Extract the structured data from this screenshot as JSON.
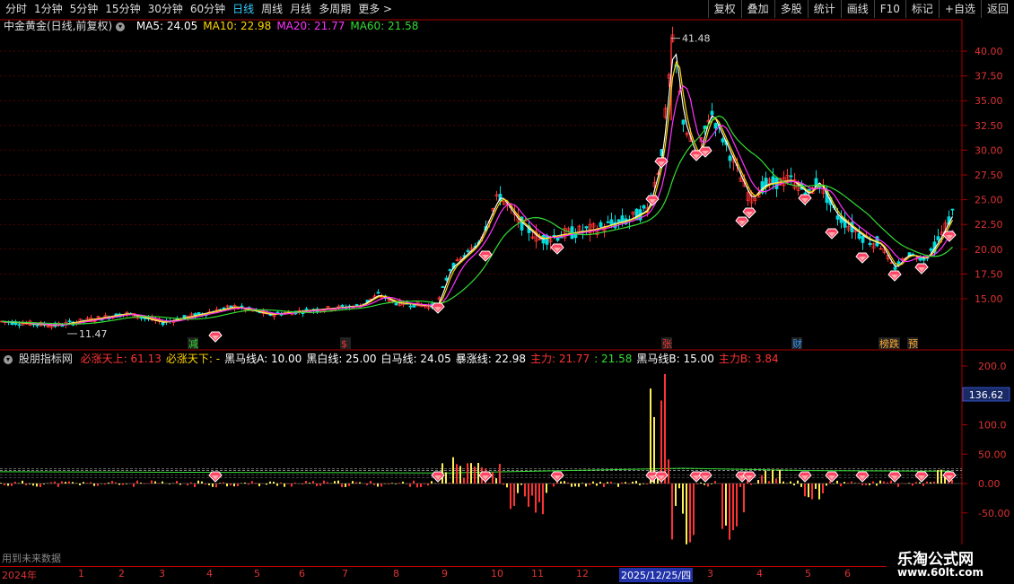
{
  "toolbar": {
    "periods": [
      "分时",
      "1分钟",
      "5分钟",
      "15分钟",
      "30分钟",
      "60分钟",
      "日线",
      "周线",
      "月线",
      "多周期",
      "更多 >"
    ],
    "active_period": "日线",
    "right_buttons": [
      "复权",
      "叠加",
      "多股",
      "统计",
      "画线",
      "F10",
      "标记",
      "+自选",
      "返回"
    ]
  },
  "main_panel": {
    "title": "中金黄金(日线,前复权)",
    "ma": [
      {
        "label": "MA5: 24.05",
        "color": "#ffffff"
      },
      {
        "label": "MA10: 22.98",
        "color": "#ffd400"
      },
      {
        "label": "MA20: 21.77",
        "color": "#ff33ff"
      },
      {
        "label": "MA60: 21.58",
        "color": "#33dd33"
      }
    ],
    "high_label": "41.48",
    "low_label": "11.47",
    "y_ticks": [
      "40.00",
      "37.50",
      "35.00",
      "32.50",
      "30.00",
      "27.50",
      "25.00",
      "22.50",
      "20.00",
      "17.50",
      "15.00"
    ],
    "markers": [
      {
        "text": "减",
        "color": "#33dd33"
      },
      {
        "text": "$",
        "color": "#ff3333"
      },
      {
        "text": "张",
        "color": "#ff3333"
      },
      {
        "text": "财",
        "color": "#3399ff"
      },
      {
        "text": "榜跌",
        "color": "#ffaa33"
      },
      {
        "text": "预",
        "color": "#ffaa33"
      }
    ]
  },
  "indicator_panel": {
    "title": "股朋指标网",
    "lines": [
      {
        "label": "必涨天上: 61.13",
        "color": "#ff3333"
      },
      {
        "label": "必涨天下: -",
        "color": "#ffd400"
      },
      {
        "label": "黑马线A: 10.00",
        "color": "#ffffff"
      },
      {
        "label": "黑白线: 25.00",
        "color": "#ffffff"
      },
      {
        "label": "白马线: 24.05",
        "color": "#ffffff"
      },
      {
        "label": "暴涨线: 22.98",
        "color": "#ffffff"
      },
      {
        "label": "主力: 21.77",
        "color": "#ff3333"
      },
      {
        "label": ": 21.58",
        "color": "#33dd33"
      },
      {
        "label": "黑马线B: 15.00",
        "color": "#ffffff"
      },
      {
        "label": "主力B: 3.84",
        "color": "#ff3333"
      }
    ],
    "y_ticks": [
      "200.0",
      "150.0",
      "100.0",
      "50.00",
      "0.00",
      "-50.00"
    ],
    "current_value": "136.62"
  },
  "x_axis": {
    "labels": [
      "2024年",
      "1",
      "2",
      "3",
      "4",
      "5",
      "6",
      "7",
      "8",
      "9",
      "10",
      "11",
      "12",
      "2025/12/25/四",
      "3",
      "4",
      "5",
      "6"
    ],
    "highlight": "2025/12/25/四"
  },
  "footer": {
    "future_data": "用到未来数据",
    "watermark_title": "乐淘公式网",
    "watermark_url": "www.60lt.com"
  },
  "colors": {
    "up": "#ff3333",
    "down": "#00ffff",
    "bg": "#000000",
    "grid": "#660000"
  }
}
